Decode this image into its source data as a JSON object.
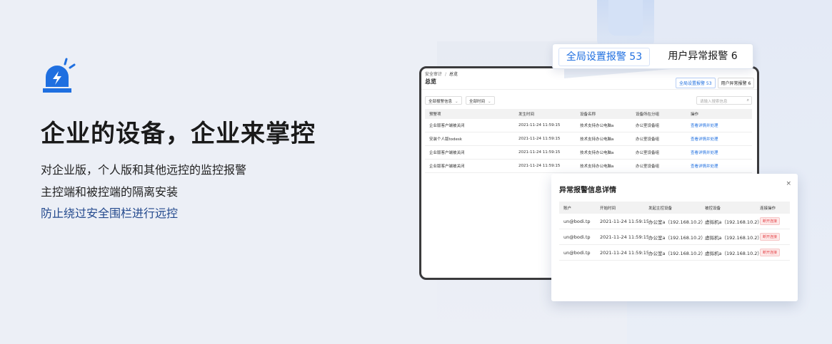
{
  "hero": {
    "title": "企业的设备，企业来掌控",
    "lines": [
      "对企业版，个人版和其他远控的监控报警",
      "主控端和被控端的隔离安装",
      "防止绕过安全围栏进行远控"
    ],
    "icon": "siren-alarm-icon"
  },
  "colors": {
    "accent": "#1f6fe0",
    "highlight_text": "#244a8e",
    "danger": "#e5484d"
  },
  "tablet": {
    "breadcrumb": [
      "安全审计",
      "/",
      "总览"
    ],
    "title": "总览",
    "tabs": [
      "全局设置报警 53",
      "用户异常报警 6"
    ],
    "filters": [
      "全部报警信息",
      "全部时间"
    ],
    "search_placeholder": "请输入搜索信息",
    "table": {
      "headers": [
        "预警项",
        "发生时间",
        "设备名称",
        "设备所在分组",
        "操作"
      ],
      "rows": [
        [
          "企业版客户端被关闭",
          "2021-11-24 11:59:15",
          "技术支持办公电脑a",
          "办公室设备组",
          "查看详情并处理"
        ],
        [
          "安装个人版todesk",
          "2021-11-24 11:59:15",
          "技术支持办公电脑a",
          "办公室设备组",
          "查看详情并处理"
        ],
        [
          "企业版客户端被关闭",
          "2021-11-24 11:59:15",
          "技术支持办公电脑a",
          "办公室设备组",
          "查看详情并处理"
        ],
        [
          "企业版客户端被关闭",
          "2021-11-24 11:59:15",
          "技术支持办公电脑a",
          "办公室设备组",
          "查看详情并处理"
        ]
      ]
    }
  },
  "callout": {
    "tabs": [
      "全局设置报警 53",
      "用户异常报警 6"
    ]
  },
  "modal": {
    "title": "异常报警信息详情",
    "close": "×",
    "headers": [
      "账户",
      "开始时间",
      "发起主控设备",
      "被控设备",
      "连接操作"
    ],
    "rows": [
      [
        "un@bodi.tp",
        "2021-11-24 11:59:15",
        "办公室a（192.168.10.2）",
        "虚拟机a（192.168.10.2）",
        "断开连接"
      ],
      [
        "un@bodi.tp",
        "2021-11-24 11:59:15",
        "办公室a（192.168.10.2）",
        "虚拟机a（192.168.10.2）",
        "断开连接"
      ],
      [
        "un@bodi.tp",
        "2021-11-24 11:59:15",
        "办公室a（192.168.10.2）",
        "虚拟机a（192.168.10.2）",
        "断开连接"
      ]
    ]
  }
}
